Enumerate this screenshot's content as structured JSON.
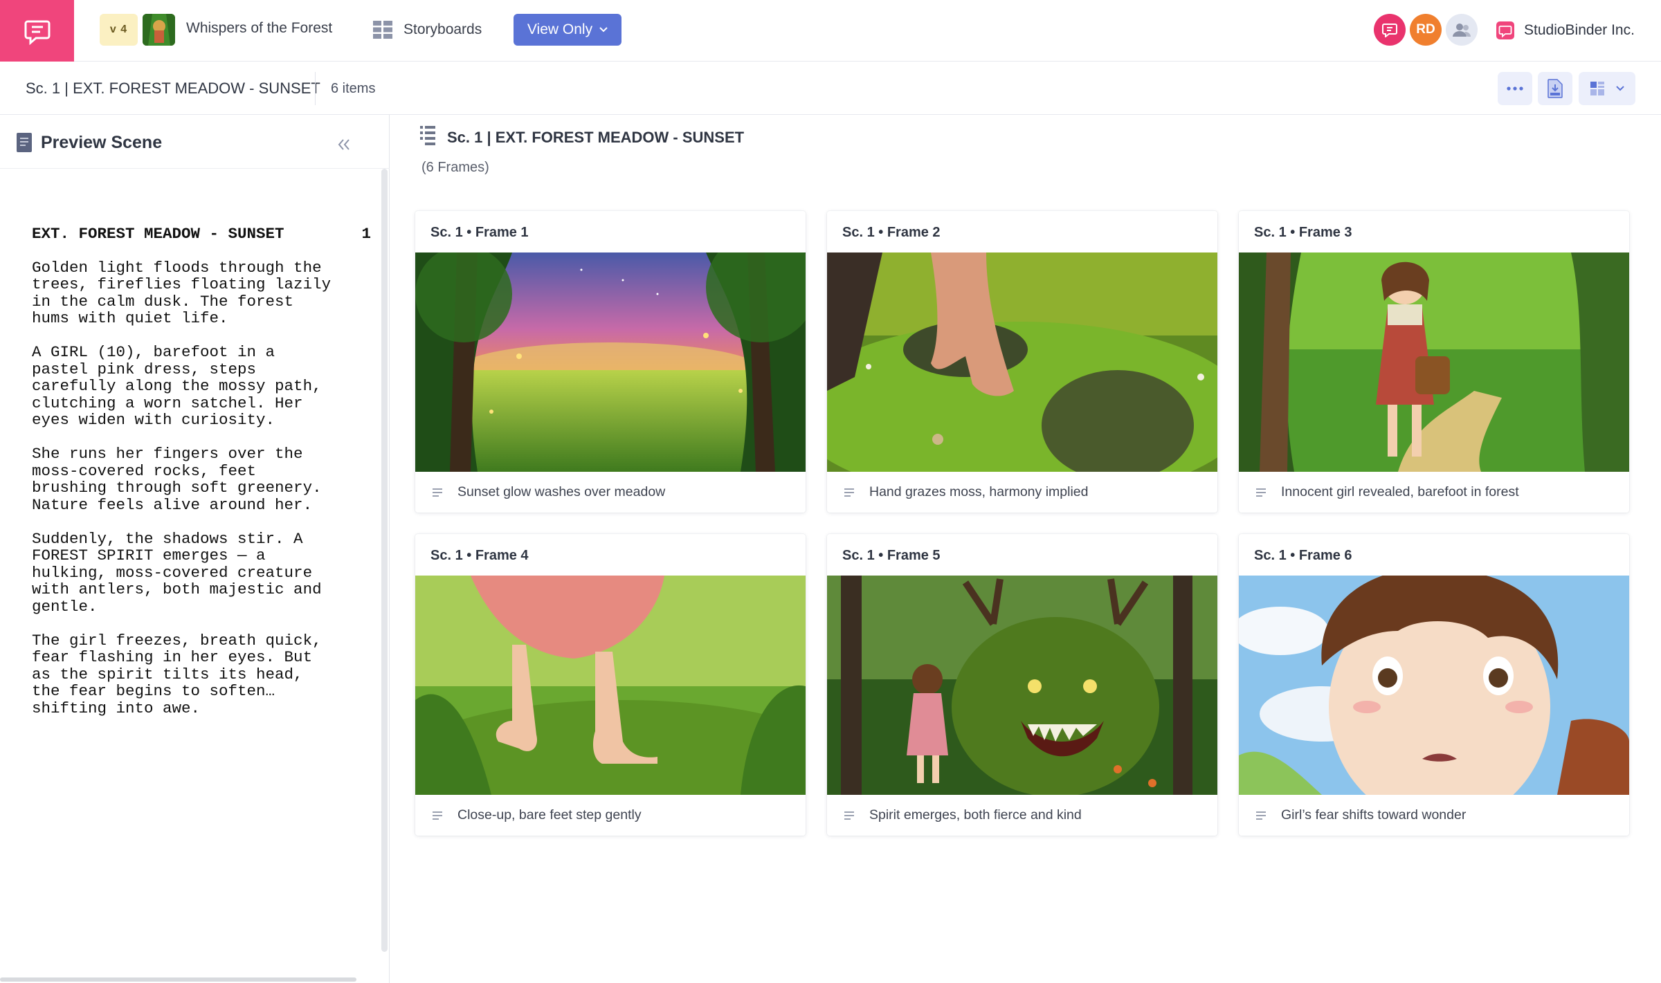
{
  "topbar": {
    "version": "v 4",
    "project_name": "Whispers of the Forest",
    "nav_storyboards": "Storyboards",
    "view_mode": "View Only",
    "avatars": [
      {
        "initials": "",
        "color": "#e9336d",
        "icon": "chat-icon"
      },
      {
        "initials": "RD",
        "color": "#f07f2e"
      },
      {
        "initials": "",
        "color": "#e4e8f2",
        "icon": "team-icon"
      }
    ],
    "company": "StudioBinder Inc.",
    "brand_color": "#f0457c",
    "accent_color": "#5a73d6"
  },
  "subbar": {
    "scene": "Sc. 1 | EXT. FOREST MEADOW - SUNSET",
    "items": "6 items"
  },
  "preview": {
    "title": "Preview Scene",
    "heading": "EXT. FOREST MEADOW - SUNSET",
    "scene_number": "1",
    "paragraphs": [
      "Golden light floods through the\ntrees, fireflies floating lazily\nin the calm dusk. The forest\nhums with quiet life.",
      "A GIRL (10), barefoot in a\npastel pink dress, steps\ncarefully along the mossy path,\nclutching a worn satchel. Her\neyes widen with curiosity.",
      "She runs her fingers over the\nmoss-covered rocks, feet\nbrushing through soft greenery.\nNature feels alive around her.",
      "Suddenly, the shadows stir. A\nFOREST SPIRIT emerges — a\nhulking, moss-covered creature\nwith antlers, both majestic and\ngentle.",
      "The girl freezes, breath quick,\nfear flashing in her eyes. But\nas the spirit tilts its head,\nthe fear begins to soften…\nshifting into awe."
    ]
  },
  "main": {
    "title": "Sc. 1 | EXT. FOREST MEADOW - SUNSET",
    "frame_count": "(6 Frames)",
    "frames": [
      {
        "label": "Sc. 1 • Frame  1",
        "caption": "Sunset glow washes over meadow",
        "image": "sunset-meadow"
      },
      {
        "label": "Sc. 1 • Frame  2",
        "caption": "Hand grazes moss, harmony implied",
        "image": "hand-on-moss"
      },
      {
        "label": "Sc. 1 • Frame  3",
        "caption": "Innocent girl revealed, barefoot in forest",
        "image": "girl-on-path"
      },
      {
        "label": "Sc. 1 • Frame  4",
        "caption": "Close-up, bare feet step gently",
        "image": "bare-feet"
      },
      {
        "label": "Sc. 1 • Frame  5",
        "caption": "Spirit emerges, both fierce and kind",
        "image": "forest-spirit"
      },
      {
        "label": "Sc. 1 • Frame  6",
        "caption": "Girl’s fear shifts toward wonder",
        "image": "girl-closeup"
      }
    ]
  }
}
